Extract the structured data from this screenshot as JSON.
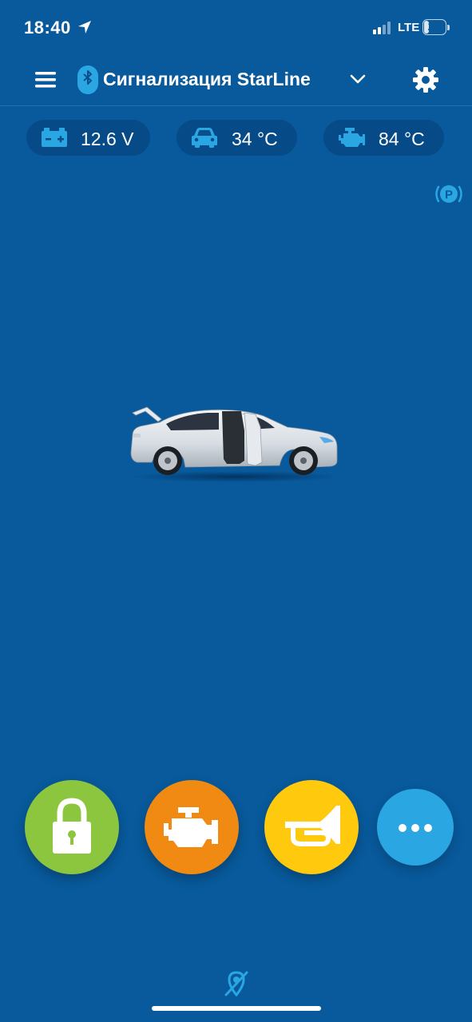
{
  "status_bar": {
    "time": "18:40",
    "network": "LTE",
    "battery": "22",
    "battery_level_percent": 22
  },
  "header": {
    "title": "Сигнализация StarLine"
  },
  "indicators": {
    "battery_voltage": "12.6 V",
    "cabin_temp": "34 °C",
    "engine_temp": "84 °C"
  },
  "colors": {
    "background": "#085a9c",
    "accent": "#2aa6e3",
    "lock": "#8cc63f",
    "engine": "#f08a12",
    "horn": "#ffc90e",
    "more": "#2aa6e3"
  }
}
